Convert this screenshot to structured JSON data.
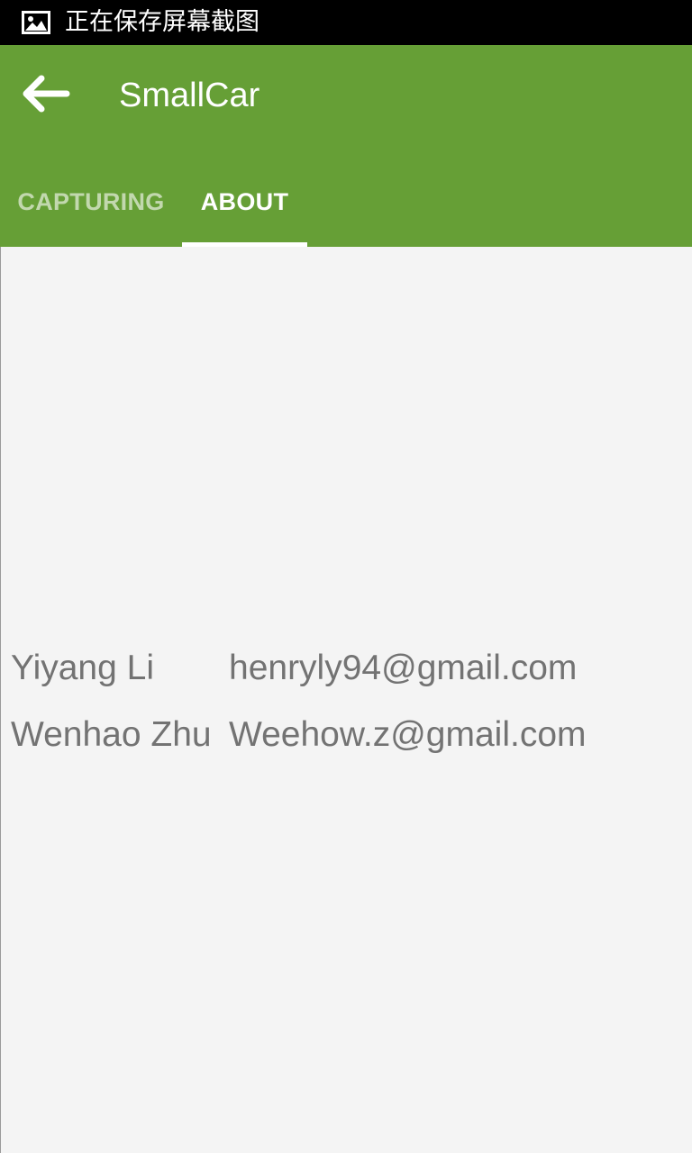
{
  "status_bar": {
    "icon": "image-icon",
    "text": "正在保存屏幕截图"
  },
  "app_bar": {
    "back_icon": "arrow-left-icon",
    "title": "SmallCar",
    "color": "#669f36"
  },
  "tabs": [
    {
      "label": "CAPTURING",
      "selected": false
    },
    {
      "label": "ABOUT",
      "selected": true
    }
  ],
  "contacts": [
    {
      "name": "Yiyang Li",
      "email": "henryly94@gmail.com"
    },
    {
      "name": "Wenhao Zhu",
      "email": "Weehow.z@gmail.com"
    }
  ]
}
